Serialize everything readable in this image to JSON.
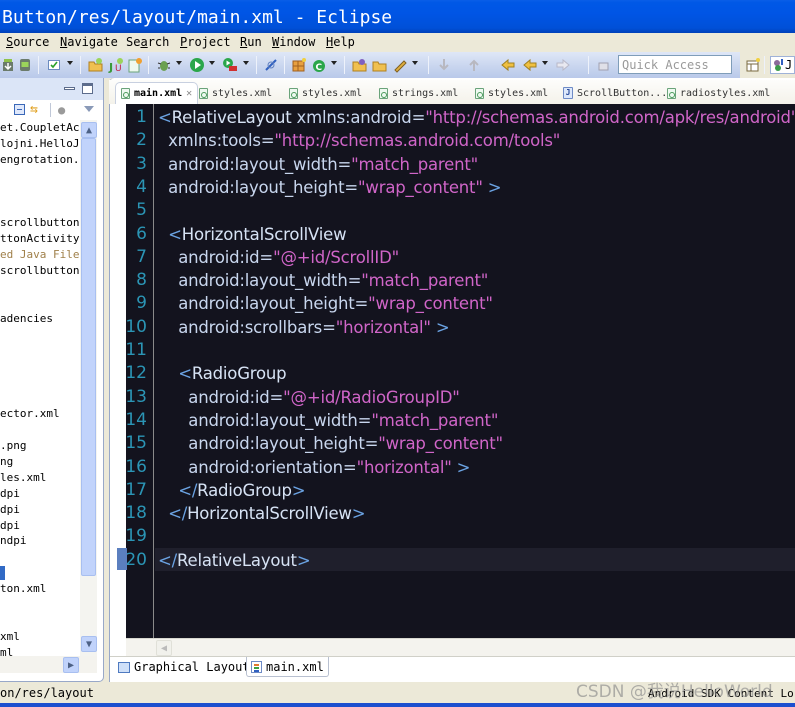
{
  "window": {
    "title": "Button/res/layout/main.xml - Eclipse"
  },
  "menu": {
    "items": [
      {
        "label": "Source",
        "mnemonic": "S"
      },
      {
        "label": "Navigate",
        "mnemonic": "N"
      },
      {
        "label": "Search",
        "mnemonic": "a"
      },
      {
        "label": "Project",
        "mnemonic": "P"
      },
      {
        "label": "Run",
        "mnemonic": "R"
      },
      {
        "label": "Window",
        "mnemonic": "W"
      },
      {
        "label": "Help",
        "mnemonic": "H"
      }
    ]
  },
  "toolbar": {
    "quick_access_placeholder": "Quick Access",
    "perspective_label": "J",
    "icons": [
      "android-sdk-manager-icon",
      "android-avd-manager-icon",
      "checkbox-icon",
      "new-project-icon",
      "new-junit-icon",
      "new-android-xml-icon",
      "debug-icon",
      "run-icon",
      "external-tools-icon",
      "toggle-mark-occurrences-icon",
      "open-type-icon",
      "new-class-icon",
      "open-folder-icon",
      "open-folder-icon-2",
      "pen-icon",
      "next-annotation-icon",
      "prev-annotation-icon",
      "last-edit-icon",
      "back-icon",
      "forward-icon",
      "pin-editor-icon",
      "open-perspective-icon",
      "java-perspective-icon"
    ]
  },
  "package_explorer": {
    "rows": [
      {
        "text": "et.CoupletAc",
        "kind": "normal"
      },
      {
        "text": "lojni.HelloJ",
        "kind": "normal"
      },
      {
        "text": "engrotation.",
        "kind": "normal"
      },
      {
        "text": "",
        "kind": "normal"
      },
      {
        "text": "",
        "kind": "normal"
      },
      {
        "text": "",
        "kind": "normal"
      },
      {
        "text": "scrollbutton",
        "kind": "normal"
      },
      {
        "text": "ttonActivity",
        "kind": "normal"
      },
      {
        "text": "ed Java Files",
        "kind": "generated"
      },
      {
        "text": "scrollbutton",
        "kind": "normal"
      },
      {
        "text": "",
        "kind": "normal"
      },
      {
        "text": "",
        "kind": "normal"
      },
      {
        "text": "adencies",
        "kind": "normal"
      },
      {
        "text": "",
        "kind": "normal"
      },
      {
        "text": "",
        "kind": "normal"
      },
      {
        "text": "",
        "kind": "normal"
      },
      {
        "text": "",
        "kind": "normal"
      },
      {
        "text": "",
        "kind": "normal"
      },
      {
        "text": "ector.xml",
        "kind": "normal"
      },
      {
        "text": "",
        "kind": "normal"
      },
      {
        "text": ".png",
        "kind": "normal"
      },
      {
        "text": "ng",
        "kind": "normal"
      },
      {
        "text": "les.xml",
        "kind": "normal"
      },
      {
        "text": "dpi",
        "kind": "normal"
      },
      {
        "text": "dpi",
        "kind": "normal"
      },
      {
        "text": "dpi",
        "kind": "normal"
      },
      {
        "text": "ndpi",
        "kind": "normal"
      },
      {
        "text": "",
        "kind": "normal"
      },
      {
        "text": "",
        "kind": "selected"
      },
      {
        "text": "ton.xml",
        "kind": "normal"
      },
      {
        "text": "",
        "kind": "normal"
      },
      {
        "text": "",
        "kind": "normal"
      },
      {
        "text": "xml",
        "kind": "normal"
      },
      {
        "text": "ml",
        "kind": "normal"
      }
    ]
  },
  "editor": {
    "tabs": [
      {
        "label": "main.xml",
        "active": true,
        "icon": "android-xml-file-icon"
      },
      {
        "label": "styles.xml",
        "active": false,
        "icon": "android-xml-file-icon"
      },
      {
        "label": "styles.xml",
        "active": false,
        "icon": "android-xml-file-icon"
      },
      {
        "label": "strings.xml",
        "active": false,
        "icon": "android-xml-file-icon"
      },
      {
        "label": "styles.xml",
        "active": false,
        "icon": "android-xml-file-icon"
      },
      {
        "label": "ScrollButton...",
        "active": false,
        "icon": "java-file-icon"
      },
      {
        "label": "radiostyles.xml",
        "active": false,
        "icon": "android-xml-file-icon"
      }
    ],
    "current_line": 20,
    "lines": [
      {
        "n": "1",
        "indent": "",
        "tokens": [
          [
            "tag",
            "<"
          ],
          [
            "name",
            "RelativeLayout"
          ],
          [
            "attr",
            " xmlns:android"
          ],
          [
            "eq",
            "="
          ],
          [
            "val",
            "\"http://schemas.android.com/apk/res/android\""
          ]
        ]
      },
      {
        "n": "2",
        "indent": "  ",
        "tokens": [
          [
            "attr",
            "xmlns:tools"
          ],
          [
            "eq",
            "="
          ],
          [
            "val",
            "\"http://schemas.android.com/tools\""
          ]
        ]
      },
      {
        "n": "3",
        "indent": "  ",
        "tokens": [
          [
            "attr",
            "android:layout_width"
          ],
          [
            "eq",
            "="
          ],
          [
            "val",
            "\"match_parent\""
          ]
        ]
      },
      {
        "n": "4",
        "indent": "  ",
        "tokens": [
          [
            "attr",
            "android:layout_height"
          ],
          [
            "eq",
            "="
          ],
          [
            "val",
            "\"wrap_content\""
          ],
          [
            "tag",
            " >"
          ]
        ]
      },
      {
        "n": "5",
        "indent": "",
        "tokens": []
      },
      {
        "n": "6",
        "indent": "  ",
        "tokens": [
          [
            "tag",
            "<"
          ],
          [
            "name",
            "HorizontalScrollView"
          ]
        ]
      },
      {
        "n": "7",
        "indent": "    ",
        "tokens": [
          [
            "attr",
            "android:id"
          ],
          [
            "eq",
            "="
          ],
          [
            "val",
            "\"@+id/ScrollID\""
          ]
        ]
      },
      {
        "n": "8",
        "indent": "    ",
        "tokens": [
          [
            "attr",
            "android:layout_width"
          ],
          [
            "eq",
            "="
          ],
          [
            "val",
            "\"match_parent\""
          ]
        ]
      },
      {
        "n": "9",
        "indent": "    ",
        "tokens": [
          [
            "attr",
            "android:layout_height"
          ],
          [
            "eq",
            "="
          ],
          [
            "val",
            "\"wrap_content\""
          ]
        ]
      },
      {
        "n": "10",
        "indent": "    ",
        "tokens": [
          [
            "attr",
            "android:scrollbars"
          ],
          [
            "eq",
            "="
          ],
          [
            "val",
            "\"horizontal\""
          ],
          [
            "tag",
            " >"
          ]
        ]
      },
      {
        "n": "11",
        "indent": "",
        "tokens": []
      },
      {
        "n": "12",
        "indent": "    ",
        "tokens": [
          [
            "tag",
            "<"
          ],
          [
            "name",
            "RadioGroup"
          ]
        ]
      },
      {
        "n": "13",
        "indent": "      ",
        "tokens": [
          [
            "attr",
            "android:id"
          ],
          [
            "eq",
            "="
          ],
          [
            "val",
            "\"@+id/RadioGroupID\""
          ]
        ]
      },
      {
        "n": "14",
        "indent": "      ",
        "tokens": [
          [
            "attr",
            "android:layout_width"
          ],
          [
            "eq",
            "="
          ],
          [
            "val",
            "\"match_parent\""
          ]
        ]
      },
      {
        "n": "15",
        "indent": "      ",
        "tokens": [
          [
            "attr",
            "android:layout_height"
          ],
          [
            "eq",
            "="
          ],
          [
            "val",
            "\"wrap_content\""
          ]
        ]
      },
      {
        "n": "16",
        "indent": "      ",
        "tokens": [
          [
            "attr",
            "android:orientation"
          ],
          [
            "eq",
            "="
          ],
          [
            "val",
            "\"horizontal\""
          ],
          [
            "tag",
            " >"
          ]
        ]
      },
      {
        "n": "17",
        "indent": "    ",
        "tokens": [
          [
            "tag",
            "</"
          ],
          [
            "name",
            "RadioGroup"
          ],
          [
            "tag",
            ">"
          ]
        ]
      },
      {
        "n": "18",
        "indent": "  ",
        "tokens": [
          [
            "tag",
            "</"
          ],
          [
            "name",
            "HorizontalScrollView"
          ],
          [
            "tag",
            ">"
          ]
        ]
      },
      {
        "n": "19",
        "indent": "",
        "tokens": []
      },
      {
        "n": "20",
        "indent": "",
        "tokens": [
          [
            "tag",
            "</"
          ],
          [
            "name",
            "RelativeLayout"
          ],
          [
            "tag",
            ">"
          ]
        ]
      }
    ],
    "bottom_tabs": [
      {
        "label": "Graphical Layout",
        "selected": false
      },
      {
        "label": "main.xml",
        "selected": true
      }
    ]
  },
  "statusbar": {
    "path": "on/res/layout",
    "right": "Android SDK Content Lo"
  },
  "watermark": "CSDN @我说HelloWorld",
  "colors": {
    "editor_bg": "#13131e",
    "line_number": "#2b95b5",
    "tag": "#6ba3e3",
    "attribute": "#c8d6ee",
    "value": "#d065c8",
    "titlebar": "#0055e5"
  }
}
